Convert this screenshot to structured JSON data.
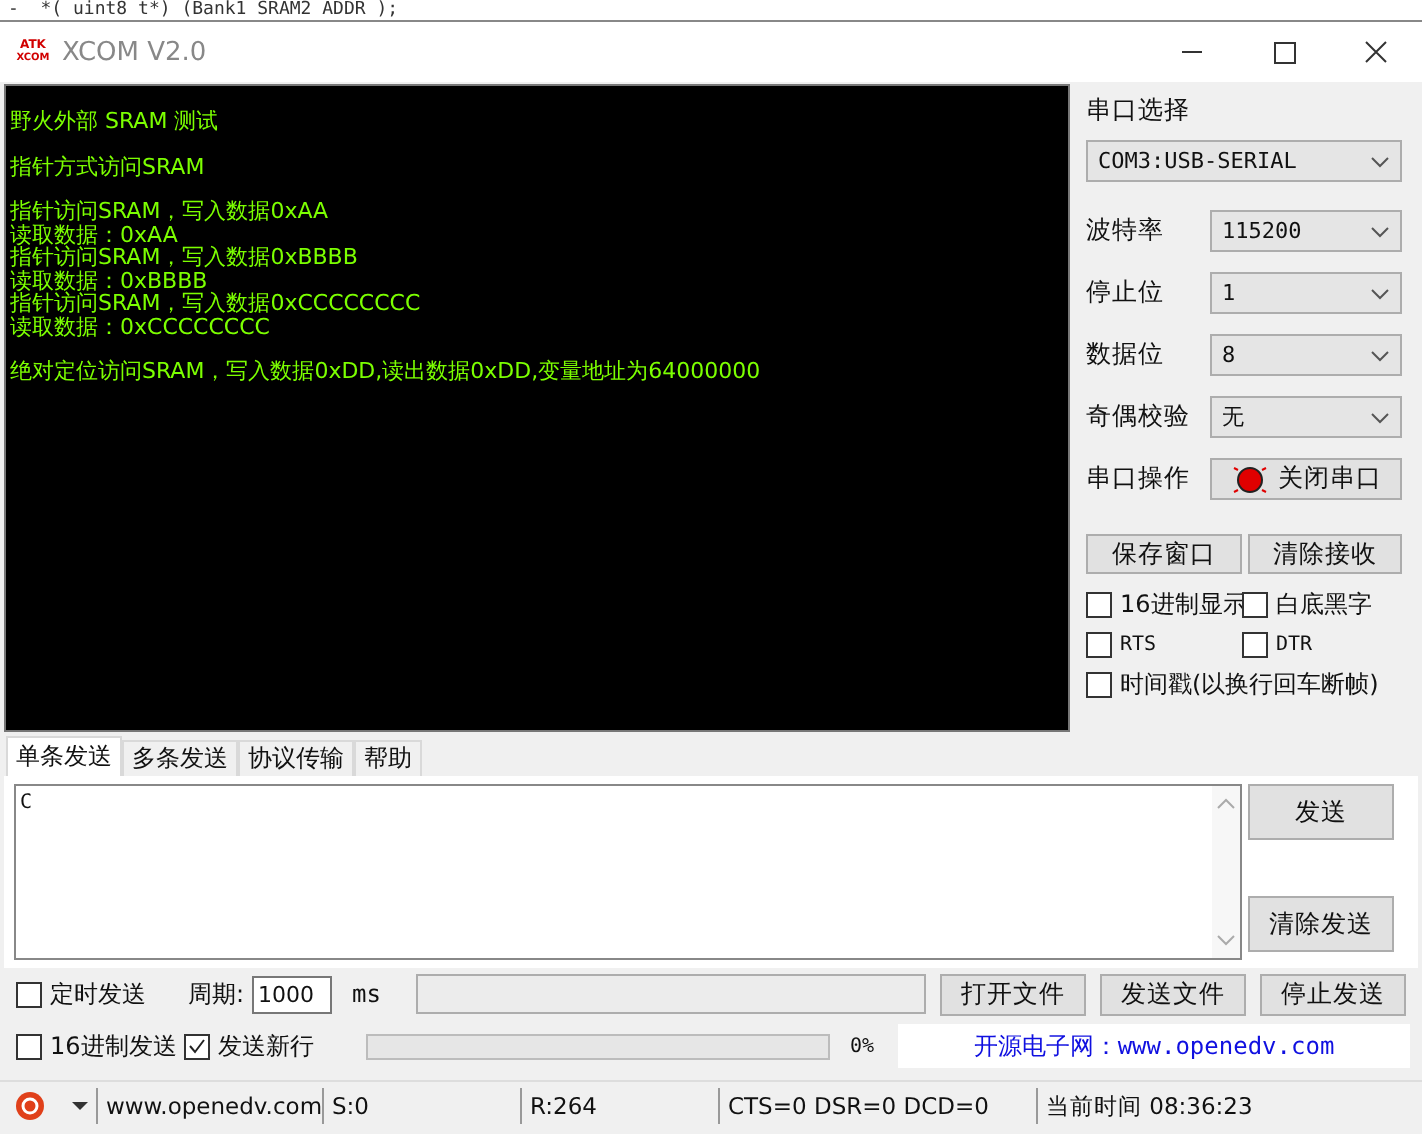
{
  "background_code": "-  *( uint8 t*) (Bank1 SRAM2 ADDR );",
  "window": {
    "title": "XCOM V2.0",
    "logo_top": "ATK",
    "logo_bottom": "XCOM"
  },
  "receive_blocks": [
    [
      "野火外部 SRAM 测试"
    ],
    [
      "指针方式访问SRAM"
    ],
    [
      "指针访问SRAM，写入数据0xAA",
      "读取数据：0xAA",
      "指针访问SRAM，写入数据0xBBBB",
      "读取数据：0xBBBB",
      "指针访问SRAM，写入数据0xCCCCCCCC",
      "读取数据：0xCCCCCCCC"
    ],
    [
      "绝对定位访问SRAM，写入数据0xDD,读出数据0xDD,变量地址为64000000"
    ]
  ],
  "port_panel": {
    "title": "串口选择",
    "port": "COM3:USB-SERIAL",
    "settings": [
      {
        "label": "波特率",
        "value": "115200"
      },
      {
        "label": "停止位",
        "value": "1"
      },
      {
        "label": "数据位",
        "value": "8"
      },
      {
        "label": "奇偶校验",
        "value": "无"
      }
    ],
    "operation": {
      "label": "串口操作",
      "button": "关闭串口",
      "open": true
    }
  },
  "receive_buttons": [
    "保存窗口",
    "清除接收"
  ],
  "options": [
    {
      "label": "16进制显示",
      "checked": false
    },
    {
      "label": "白底黑字",
      "checked": false
    },
    {
      "label": "RTS",
      "checked": false
    },
    {
      "label": "DTR",
      "checked": false
    },
    {
      "label": "时间戳(以换行回车断帧)",
      "checked": false
    }
  ],
  "tabs": [
    {
      "label": "单条发送",
      "selected": true
    },
    {
      "label": "多条发送",
      "selected": false
    },
    {
      "label": "协议传输",
      "selected": false
    },
    {
      "label": "帮助",
      "selected": false
    }
  ],
  "send_text": "C",
  "send_buttons": [
    "发送",
    "清除发送"
  ],
  "timed_send": {
    "label": "定时发送",
    "checked": false
  },
  "period_label": "周期:",
  "period": "1000",
  "period_unit": "ms",
  "file_buttons": [
    "打开文件",
    "发送文件",
    "停止发送"
  ],
  "hex_send": {
    "label": "16进制发送",
    "checked": false
  },
  "new_line": {
    "label": "发送新行",
    "checked": true
  },
  "progress": {
    "level": 0,
    "reading": "0%"
  },
  "banner": "开源电子网：www.openedv.com",
  "status_bar": [
    "www.openedv.com",
    "S:0",
    "R:264",
    "CTS=0 DSR=0 DCD=0",
    "当前时间 08:36:23"
  ]
}
